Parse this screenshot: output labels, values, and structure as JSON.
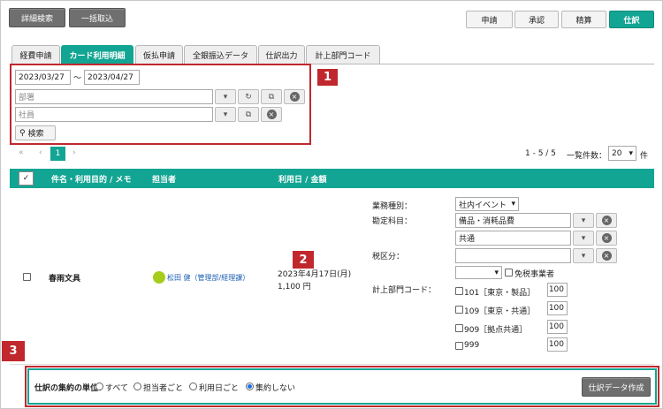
{
  "top_buttons": {
    "detail_search": "詳細検索",
    "bulk_import": "一括取込"
  },
  "mode_tabs": [
    "申請",
    "承認",
    "精算",
    "仕訳"
  ],
  "tabs": [
    "経費申請",
    "カード利用明細",
    "仮払申請",
    "全銀振込データ",
    "仕訳出力",
    "計上部門コード"
  ],
  "filters": {
    "date_from": "2023/03/27",
    "date_sep": "〜",
    "date_to": "2023/04/27",
    "department_placeholder": "部署",
    "employee_placeholder": "社員",
    "search_label": "検索"
  },
  "markers": [
    "1",
    "2",
    "3"
  ],
  "pagination": {
    "first": "«",
    "prev": "‹",
    "current": "1",
    "next": "›",
    "range": "1 - 5 / 5",
    "per_page_label": "一覧件数：",
    "per_page": "20",
    "unit": "件"
  },
  "table_header": {
    "check": "✓",
    "subject": "件名・利用目的 / メモ",
    "person": "担当者",
    "date_amount": "利用日 / 金額"
  },
  "row": {
    "subject": "春雨文具",
    "person": "松田 健（管理部/経理課）",
    "date": "2023年4月17日(月)",
    "amount": "1,100 円",
    "business_type_label": "業務種別：",
    "business_type": "社内イベント",
    "account_label": "勘定科目：",
    "account_main": "備品・消耗品費",
    "account_sub": "共通",
    "tax_label": "税区分：",
    "tax_exempt_label": "免税事業者",
    "dept_code_label": "計上部門コード：",
    "dept_codes": [
      {
        "code": "101［東京・製品］",
        "value": "100"
      },
      {
        "code": "109［東京・共通］",
        "value": "100"
      },
      {
        "code": "909［拠点共通］",
        "value": "100"
      },
      {
        "code": "999",
        "value": "100"
      }
    ]
  },
  "footer": {
    "unit_label": "仕訳の集約の単位：",
    "options": [
      "すべて",
      "担当者ごと",
      "利用日ごと",
      "集約しない"
    ],
    "selected": "集約しない",
    "create_button": "仕訳データ作成"
  },
  "colors": {
    "teal": "#13a593",
    "red": "#c0282d",
    "avatar": "#a8cc1c"
  }
}
